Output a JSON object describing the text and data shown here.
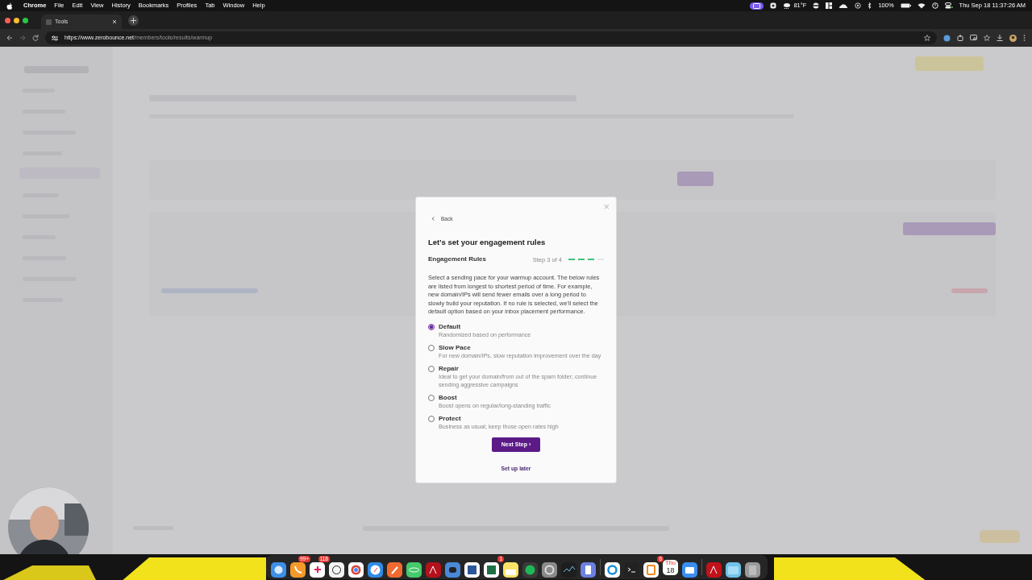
{
  "menu_bar": {
    "app": "Chrome",
    "menus": [
      "File",
      "Edit",
      "View",
      "History",
      "Bookmarks",
      "Profiles",
      "Tab",
      "Window",
      "Help"
    ],
    "weather": "81°F",
    "battery": "100%",
    "clock": "Thu Sep 18 11:37:26 AM"
  },
  "browser": {
    "tabs": [
      {
        "title": "Tools",
        "selected": true
      }
    ],
    "url_host": "https://www.zerobounce.net",
    "url_path": "/members/tools/results/warmup"
  },
  "modal": {
    "back": "Back",
    "close": "×",
    "title": "Let's set your engagement rules",
    "section": "Engagement Rules",
    "step": "Step 3 of 4",
    "progress_segments": [
      {
        "done": true
      },
      {
        "done": true
      },
      {
        "done": true
      },
      {
        "done": false
      }
    ],
    "description": "Select a sending pace for your warmup account. The below rules are listed from longest to shortest period of time. For example, new domain/IPs will send fewer emails over a long period to slowly build your reputation. If no rule is selected, we'll select the default option based on your inbox placement performance.",
    "options": [
      {
        "label": "Default",
        "detail": "Randomized based on performance",
        "selected": true
      },
      {
        "label": "Slow Pace",
        "detail": "For new domain/IPs, slow reputation improvement over the day",
        "selected": false
      },
      {
        "label": "Repair",
        "detail": "Ideal to get your domain/from out of the spam folder; continue sending aggressive campaigns",
        "selected": false
      },
      {
        "label": "Boost",
        "detail": "Boost opens on regular/long-standing traffic",
        "selected": false
      },
      {
        "label": "Protect",
        "detail": "Business as usual; keep those open rates high",
        "selected": false
      }
    ],
    "primary_button": "Next Step ›",
    "secondary_link": "Set up later"
  },
  "dock": {
    "badges": [
      "99+",
      "118",
      "1",
      "6"
    ],
    "calendar_month": "Thu",
    "calendar_day": "18"
  }
}
